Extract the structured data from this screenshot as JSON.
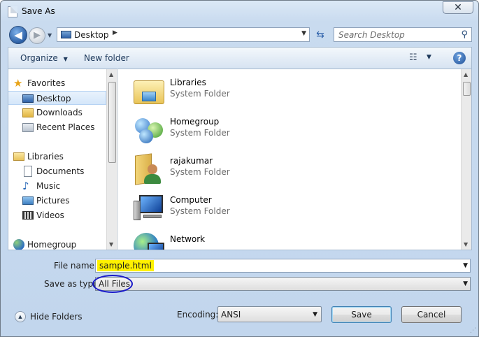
{
  "window": {
    "title": "Save As",
    "close_label": "✕"
  },
  "nav": {
    "address": "Desktop",
    "search_placeholder": "Search Desktop"
  },
  "toolbar": {
    "organize": "Organize",
    "new_folder": "New folder"
  },
  "sidebar": {
    "items": [
      {
        "label": "Favorites",
        "icon": "star-icon",
        "header": true
      },
      {
        "label": "Desktop",
        "icon": "desktop-icon",
        "selected": true
      },
      {
        "label": "Downloads",
        "icon": "downloads-icon"
      },
      {
        "label": "Recent Places",
        "icon": "recent-places-icon"
      },
      {
        "label": "Libraries",
        "icon": "libraries-icon",
        "header": true
      },
      {
        "label": "Documents",
        "icon": "documents-icon"
      },
      {
        "label": "Music",
        "icon": "music-icon"
      },
      {
        "label": "Pictures",
        "icon": "pictures-icon"
      },
      {
        "label": "Videos",
        "icon": "videos-icon"
      },
      {
        "label": "Homegroup",
        "icon": "homegroup-icon",
        "header": true
      }
    ]
  },
  "files": [
    {
      "name": "Libraries",
      "type": "System Folder",
      "icon": "libraries-folder-icon"
    },
    {
      "name": "Homegroup",
      "type": "System Folder",
      "icon": "homegroup-icon"
    },
    {
      "name": "rajakumar",
      "type": "System Folder",
      "icon": "user-folder-icon"
    },
    {
      "name": "Computer",
      "type": "System Folder",
      "icon": "computer-icon"
    },
    {
      "name": "Network",
      "type": "",
      "icon": "network-icon"
    }
  ],
  "form": {
    "file_name_label": "File name:",
    "file_name_value": "sample.html",
    "save_type_label": "Save as type:",
    "save_type_value": "All Files",
    "hide_folders": "Hide Folders",
    "encoding_label": "Encoding:",
    "encoding_value": "ANSI",
    "save_button": "Save",
    "cancel_button": "Cancel"
  },
  "colors": {
    "highlight": "#fff200",
    "annotation_circle": "#1a1ac8",
    "accent": "#2b5fa5"
  }
}
